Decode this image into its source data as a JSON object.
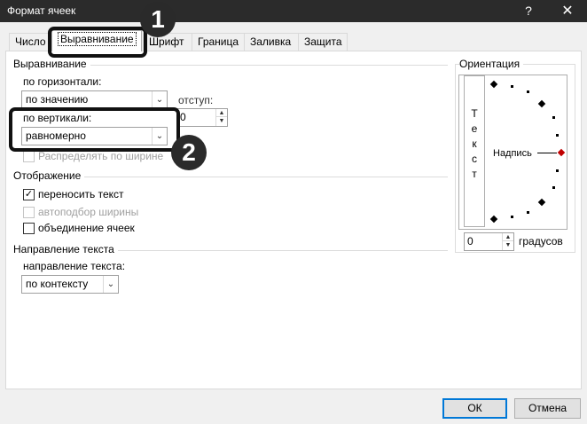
{
  "window": {
    "title": "Формат ячеек",
    "help": "?",
    "close": "✕"
  },
  "tabs": [
    {
      "label": "Число"
    },
    {
      "label": "Выравнивание",
      "active": true
    },
    {
      "label": "Шрифт"
    },
    {
      "label": "Граница"
    },
    {
      "label": "Заливка"
    },
    {
      "label": "Защита"
    }
  ],
  "alignment": {
    "section": "Выравнивание",
    "horizontal_label": "по горизонтали:",
    "horizontal_value": "по значению",
    "indent_label": "отступ:",
    "indent_value": "0",
    "vertical_label": "по вертикали:",
    "vertical_value": "равномерно",
    "distribute_label": "Распределять по ширине"
  },
  "display": {
    "section": "Отображение",
    "wrap_text": "переносить текст",
    "wrap_checked": true,
    "shrink_fit": "автоподбор ширины",
    "merge_cells": "объединение ячеек"
  },
  "direction": {
    "section": "Направление текста",
    "label": "направление текста:",
    "value": "по контексту"
  },
  "orientation": {
    "section": "Ориентация",
    "vertical_text": "Т е к с т",
    "label": "Надпись",
    "degrees_value": "0",
    "degrees_label": "градусов"
  },
  "annotations": {
    "marker1": "1",
    "marker2": "2"
  },
  "buttons": {
    "ok": "ОК",
    "cancel": "Отмена"
  },
  "colors": {
    "titlebar": "#2b2b2b",
    "accent": "#0078d7",
    "orientation_handle": "#c00000"
  },
  "icons": {
    "dropdown": "chevron-down-icon",
    "spinner": "spinner-arrows-icon",
    "checkmark": "checkmark-icon"
  }
}
